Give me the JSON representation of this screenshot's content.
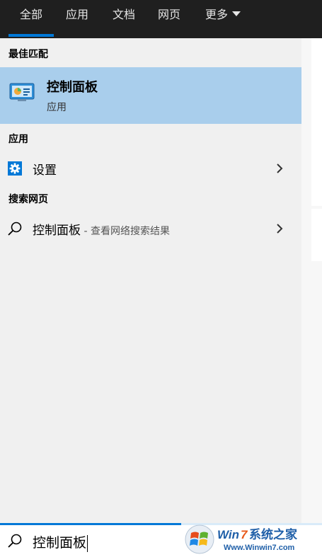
{
  "tabs": [
    {
      "label": "全部",
      "active": true
    },
    {
      "label": "应用",
      "active": false
    },
    {
      "label": "文档",
      "active": false
    },
    {
      "label": "网页",
      "active": false
    },
    {
      "label": "更多",
      "active": false
    }
  ],
  "best_match": {
    "header": "最佳匹配",
    "title": "控制面板",
    "subtitle": "应用",
    "icon": "control-panel-icon"
  },
  "apps": {
    "header": "应用",
    "items": [
      {
        "label": "设置",
        "icon": "gear-icon"
      }
    ]
  },
  "web": {
    "header": "搜索网页",
    "query": "控制面板",
    "hint": " - 查看网络搜索结果",
    "icon": "search-icon"
  },
  "search": {
    "value": "控制面板",
    "icon": "search-icon"
  },
  "watermark": {
    "brand_win": "Win",
    "brand_7": "7",
    "brand_cn": "系统之家",
    "url": "Www.Winwin7.com"
  },
  "colors": {
    "accent": "#0078d7",
    "selected_bg": "#a9ceec",
    "topbar_bg": "#1f1f1f"
  }
}
